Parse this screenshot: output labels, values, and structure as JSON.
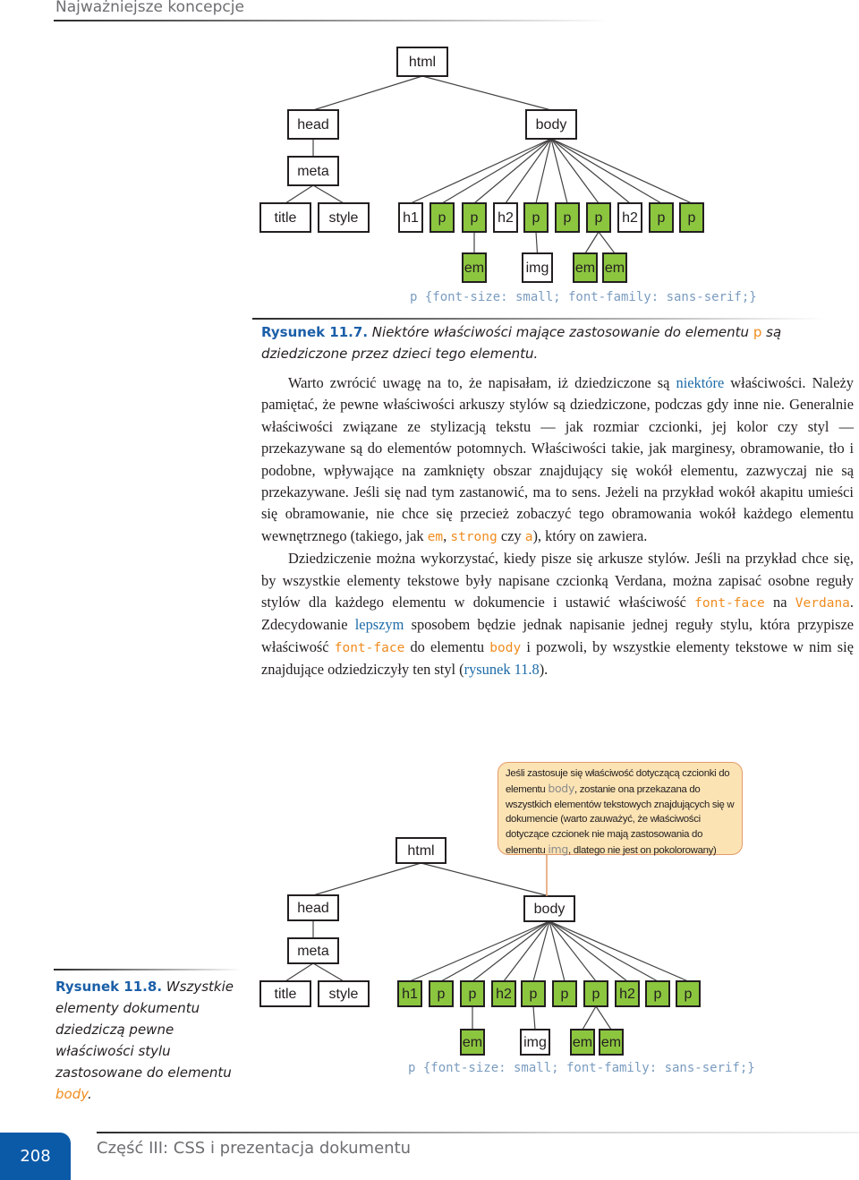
{
  "running_head": "Najważniejsze koncepcje",
  "figure_1": {
    "nodes": [
      {
        "id": "html",
        "label": "html",
        "green": false
      },
      {
        "id": "head",
        "label": "head",
        "green": false
      },
      {
        "id": "meta",
        "label": "meta",
        "green": false
      },
      {
        "id": "title",
        "label": "title",
        "green": false
      },
      {
        "id": "style",
        "label": "style",
        "green": false
      },
      {
        "id": "body",
        "label": "body",
        "green": false
      },
      {
        "id": "c1",
        "label": "h1",
        "green": false
      },
      {
        "id": "c2",
        "label": "p",
        "green": true
      },
      {
        "id": "c3",
        "label": "p",
        "green": true
      },
      {
        "id": "c4",
        "label": "h2",
        "green": false
      },
      {
        "id": "c5",
        "label": "p",
        "green": true
      },
      {
        "id": "c6",
        "label": "p",
        "green": true
      },
      {
        "id": "c7",
        "label": "p",
        "green": true
      },
      {
        "id": "c8",
        "label": "h2",
        "green": false
      },
      {
        "id": "c9",
        "label": "p",
        "green": true
      },
      {
        "id": "c10",
        "label": "p",
        "green": true
      },
      {
        "id": "g1",
        "label": "em",
        "green": true
      },
      {
        "id": "g2",
        "label": "img",
        "green": false
      },
      {
        "id": "g3",
        "label": "em",
        "green": true
      },
      {
        "id": "g4",
        "label": "em",
        "green": true
      }
    ],
    "edges": [
      [
        "html",
        "head"
      ],
      [
        "html",
        "body"
      ],
      [
        "head",
        "meta"
      ],
      [
        "meta",
        "title"
      ],
      [
        "meta",
        "style"
      ],
      [
        "body",
        "c1"
      ],
      [
        "body",
        "c2"
      ],
      [
        "body",
        "c3"
      ],
      [
        "body",
        "c4"
      ],
      [
        "body",
        "c5"
      ],
      [
        "body",
        "c6"
      ],
      [
        "body",
        "c7"
      ],
      [
        "body",
        "c8"
      ],
      [
        "body",
        "c9"
      ],
      [
        "body",
        "c10"
      ],
      [
        "c3",
        "g1"
      ],
      [
        "c5",
        "g2"
      ],
      [
        "c7",
        "g3"
      ],
      [
        "c7",
        "g4"
      ]
    ],
    "code": "p {font-size: small; font-family: sans-serif;}"
  },
  "caption_1": {
    "label": "Rysunek 11.7.",
    "text_before": " Niektóre właściwości mające zastosowanie do elementu ",
    "code": "p",
    "text_after": " są dziedziczone przez dzieci tego elementu."
  },
  "body_text": {
    "p1": {
      "a": "Warto zwrócić uwagę na to, że napisałam, iż dziedziczone są ",
      "link": "niektóre",
      "b": " właściwości. Należy pamiętać, że pewne właściwości arkuszy stylów są dziedziczone, podczas gdy inne nie. Generalnie właściwości związane ze stylizacją tekstu — jak rozmiar czcionki, jej kolor czy styl — przekazywane są do elementów potomnych. Właściwości takie, jak marginesy, obramowanie, tło i podobne, wpływające na zamknięty obszar znajdujący się wokół elementu, zazwyczaj nie są przekazywane. Jeśli się nad tym zastanowić, ma to sens. Jeżeli na przykład wokół akapitu umieści się obramowanie, nie chce się przecież zobaczyć tego obramowania wokół każdego elementu wewnętrznego (takiego, jak ",
      "code1": "em",
      "c": ", ",
      "code2": "strong",
      "d": " czy ",
      "code3": "a",
      "e": "), który on zawiera."
    },
    "p2": {
      "a": "Dziedziczenie można wykorzystać, kiedy pisze się arkusze stylów. Jeśli na przykład chce się, by wszystkie elementy tekstowe były napisane czcionką Verdana, można zapisać osobne reguły stylów dla każdego elementu w dokumencie i ustawić właściwość ",
      "code1": "font-face",
      "b": " na ",
      "code2": "Verdana",
      "c": ". Zdecydowanie ",
      "link1": "lepszym",
      "d": " sposobem będzie jednak napisanie jednej reguły stylu, która przypisze właściwość ",
      "code3": "font-face",
      "e": " do elementu ",
      "code4": "body",
      "f": " i pozwoli, by wszystkie elementy tekstowe w nim się znajdujące odziedziczyły ten styl (",
      "link2": "rysunek 11.8",
      "g": ")."
    }
  },
  "figure_2": {
    "callout": {
      "a": "Jeśli zastosuje się właściwość dotyczącą czcionki do elementu ",
      "code1": "body",
      "b": ", zostanie ona przekazana do wszystkich elementów tekstowych znajdujących się w dokumencie (warto zauważyć, że właściwości dotyczące czcionek nie mają zastosowania do elementu ",
      "code2": "img",
      "c": ", dlatego nie jest on pokolorowany)"
    },
    "nodes": [
      {
        "id": "html",
        "label": "html",
        "green": false
      },
      {
        "id": "head",
        "label": "head",
        "green": false
      },
      {
        "id": "meta",
        "label": "meta",
        "green": false
      },
      {
        "id": "title",
        "label": "title",
        "green": false
      },
      {
        "id": "style",
        "label": "style",
        "green": false
      },
      {
        "id": "body",
        "label": "body",
        "green": false
      },
      {
        "id": "c1",
        "label": "h1",
        "green": true
      },
      {
        "id": "c2",
        "label": "p",
        "green": true
      },
      {
        "id": "c3",
        "label": "p",
        "green": true
      },
      {
        "id": "c4",
        "label": "h2",
        "green": true
      },
      {
        "id": "c5",
        "label": "p",
        "green": true
      },
      {
        "id": "c6",
        "label": "p",
        "green": true
      },
      {
        "id": "c7",
        "label": "p",
        "green": true
      },
      {
        "id": "c8",
        "label": "h2",
        "green": true
      },
      {
        "id": "c9",
        "label": "p",
        "green": true
      },
      {
        "id": "c10",
        "label": "p",
        "green": true
      },
      {
        "id": "g1",
        "label": "em",
        "green": true
      },
      {
        "id": "g2",
        "label": "img",
        "green": false
      },
      {
        "id": "g3",
        "label": "em",
        "green": true
      },
      {
        "id": "g4",
        "label": "em",
        "green": true
      }
    ],
    "edges": [
      [
        "html",
        "head"
      ],
      [
        "html",
        "body"
      ],
      [
        "head",
        "meta"
      ],
      [
        "meta",
        "title"
      ],
      [
        "meta",
        "style"
      ],
      [
        "body",
        "c1"
      ],
      [
        "body",
        "c2"
      ],
      [
        "body",
        "c3"
      ],
      [
        "body",
        "c4"
      ],
      [
        "body",
        "c5"
      ],
      [
        "body",
        "c6"
      ],
      [
        "body",
        "c7"
      ],
      [
        "body",
        "c8"
      ],
      [
        "body",
        "c9"
      ],
      [
        "body",
        "c10"
      ],
      [
        "c3",
        "g1"
      ],
      [
        "c5",
        "g2"
      ],
      [
        "c7",
        "g3"
      ],
      [
        "c7",
        "g4"
      ]
    ],
    "code": "p {font-size: small; font-family: sans-serif;}"
  },
  "caption_2": {
    "label": "Rysunek 11.8.",
    "text": " Wszystkie elementy dokumentu dziedziczą pewne właściwości stylu zastosowane do elementu ",
    "code": "body",
    "end": "."
  },
  "footer": {
    "page_number": "208",
    "part_title": "Część III: CSS i prezentacja dokumentu"
  },
  "colors": {
    "green": "#8cc63f",
    "caption_blue": "#1b5fa8",
    "code_orange": "#f08c1e",
    "footer_blue": "#0b5aa8",
    "callout_bg": "#fbe3b4"
  }
}
